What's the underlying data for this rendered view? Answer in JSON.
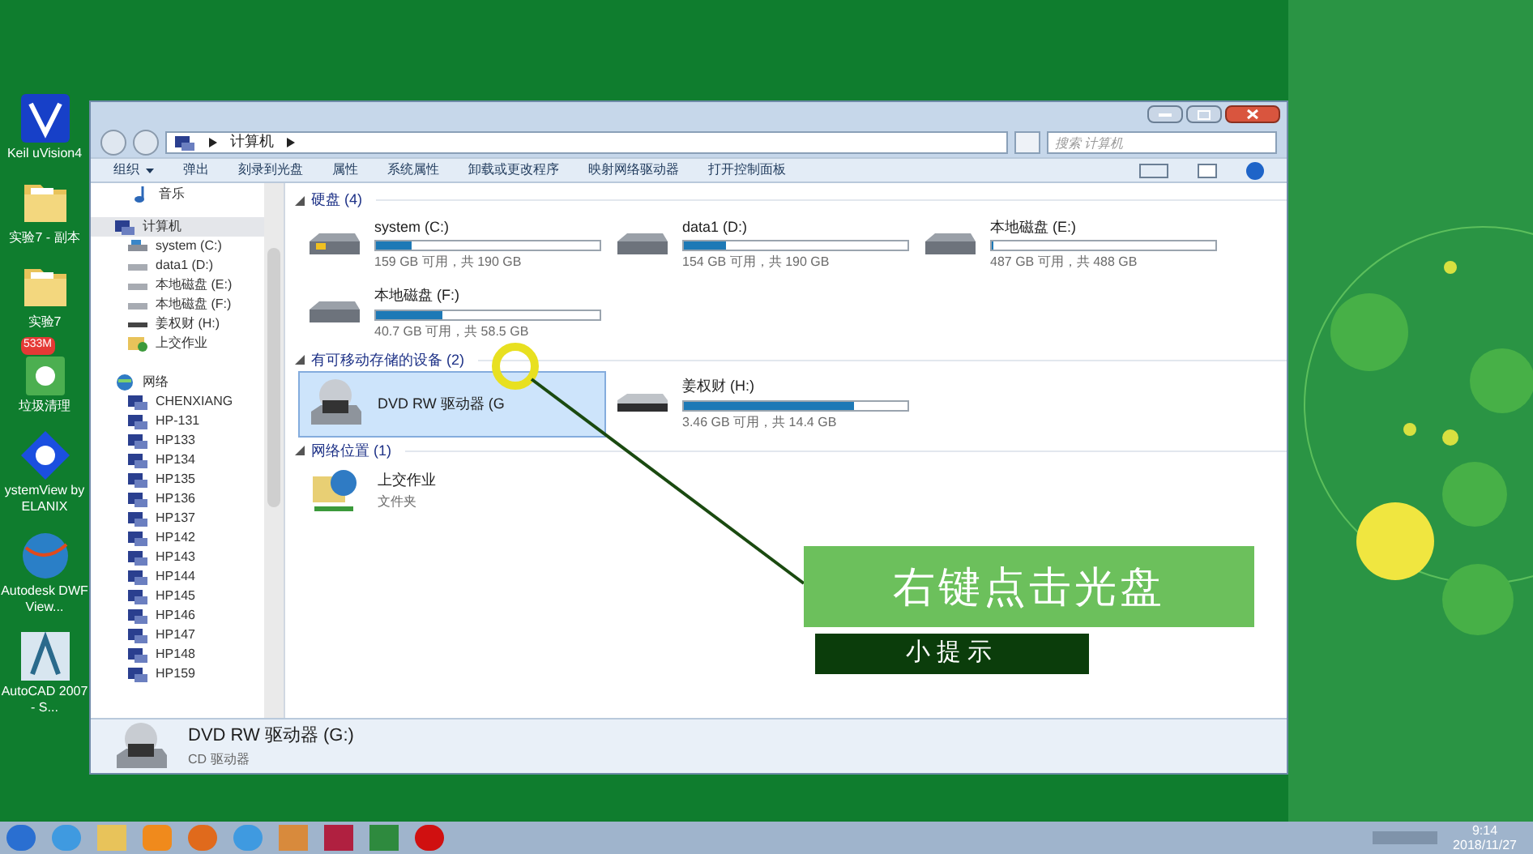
{
  "desktop_icons": [
    {
      "kind": "keil",
      "label": "Keil uVision4"
    },
    {
      "kind": "folder",
      "label": "实验7 - 副本"
    },
    {
      "kind": "folder",
      "label": "实验7"
    },
    {
      "kind": "trash",
      "label": "垃圾清理",
      "badge": "533M"
    },
    {
      "kind": "systemview",
      "label": "ystemView by ELANIX"
    },
    {
      "kind": "globe",
      "label": "Autodesk DWF View..."
    },
    {
      "kind": "autocad",
      "label": "AutoCAD 2007 - S..."
    }
  ],
  "window": {
    "address": [
      "计算机"
    ],
    "search": {
      "placeholder": "搜索 计算机"
    },
    "toolbar": [
      {
        "label": "组织",
        "dropdown": true
      },
      {
        "label": "弹出",
        "dropdown": false
      },
      {
        "label": "刻录到光盘",
        "dropdown": false
      },
      {
        "label": "属性",
        "dropdown": false
      },
      {
        "label": "系统属性",
        "dropdown": false
      },
      {
        "label": "卸载或更改程序",
        "dropdown": false
      },
      {
        "label": "映射网络驱动器",
        "dropdown": false
      },
      {
        "label": "打开控制面板",
        "dropdown": false
      }
    ],
    "sidebar": [
      {
        "kind": "music",
        "label": "音乐",
        "selected": false
      },
      {
        "kind": "computer",
        "label": "计算机",
        "selected": true,
        "children": [
          {
            "kind": "system",
            "label": "system (C:)"
          },
          {
            "kind": "disk",
            "label": "data1 (D:)"
          },
          {
            "kind": "disk",
            "label": "本地磁盘 (E:)"
          },
          {
            "kind": "disk",
            "label": "本地磁盘 (F:)"
          },
          {
            "kind": "usb",
            "label": "姜权财 (H:)"
          },
          {
            "kind": "share",
            "label": "上交作业"
          }
        ]
      },
      {
        "kind": "network",
        "label": "网络",
        "selected": false,
        "children": [
          {
            "kind": "pc",
            "label": "CHENXIANG"
          },
          {
            "kind": "pc",
            "label": "HP-131"
          },
          {
            "kind": "pc",
            "label": "HP133"
          },
          {
            "kind": "pc",
            "label": "HP134"
          },
          {
            "kind": "pc",
            "label": "HP135"
          },
          {
            "kind": "pc",
            "label": "HP136"
          },
          {
            "kind": "pc",
            "label": "HP137"
          },
          {
            "kind": "pc",
            "label": "HP142"
          },
          {
            "kind": "pc",
            "label": "HP143"
          },
          {
            "kind": "pc",
            "label": "HP144"
          },
          {
            "kind": "pc",
            "label": "HP145"
          },
          {
            "kind": "pc",
            "label": "HP146"
          },
          {
            "kind": "pc",
            "label": "HP147"
          },
          {
            "kind": "pc",
            "label": "HP148"
          },
          {
            "kind": "pc",
            "label": "HP159"
          }
        ]
      }
    ],
    "groups": [
      {
        "title": "硬盘 (4)",
        "expanded": true,
        "items": [
          {
            "kind": "system",
            "name": "system (C:)",
            "level": 0.16,
            "info": "159 GB 可用，共 190 GB",
            "selected": false
          },
          {
            "kind": "disk",
            "name": "data1 (D:)",
            "level": 0.19,
            "info": "154 GB 可用，共 190 GB",
            "selected": false
          },
          {
            "kind": "disk",
            "name": "本地磁盘 (E:)",
            "level": 0.003,
            "info": "487 GB 可用，共 488 GB",
            "selected": false
          },
          {
            "kind": "disk",
            "name": "本地磁盘 (F:)",
            "level": 0.3,
            "info": "40.7 GB 可用，共 58.5 GB",
            "selected": false
          }
        ]
      },
      {
        "title": "有可移动存储的设备 (2)",
        "expanded": true,
        "items": [
          {
            "kind": "dvd",
            "name": "DVD RW 驱动器 (G",
            "selected": true
          },
          {
            "kind": "usb",
            "name": "姜权财 (H:)",
            "level": 0.76,
            "info": "3.46 GB 可用，共 14.4 GB",
            "selected": false
          }
        ]
      },
      {
        "title": "网络位置 (1)",
        "expanded": true,
        "items": [
          {
            "kind": "share",
            "name": "上交作业",
            "info": "文件夹",
            "selected": false
          }
        ]
      }
    ],
    "details": {
      "name": "DVD RW 驱动器 (G:)",
      "type": "CD 驱动器"
    }
  },
  "annotation": {
    "caption": "右键点击光盘",
    "tip": "小提示"
  },
  "taskbar": {
    "apps": [
      {
        "kind": "start"
      },
      {
        "kind": "ie"
      },
      {
        "kind": "explorer"
      },
      {
        "kind": "media"
      },
      {
        "kind": "firefox"
      },
      {
        "kind": "ie"
      },
      {
        "kind": "network"
      },
      {
        "kind": "winrar"
      },
      {
        "kind": "excel"
      },
      {
        "kind": "record"
      }
    ],
    "time": "9:14",
    "date": "2018/11/27"
  }
}
